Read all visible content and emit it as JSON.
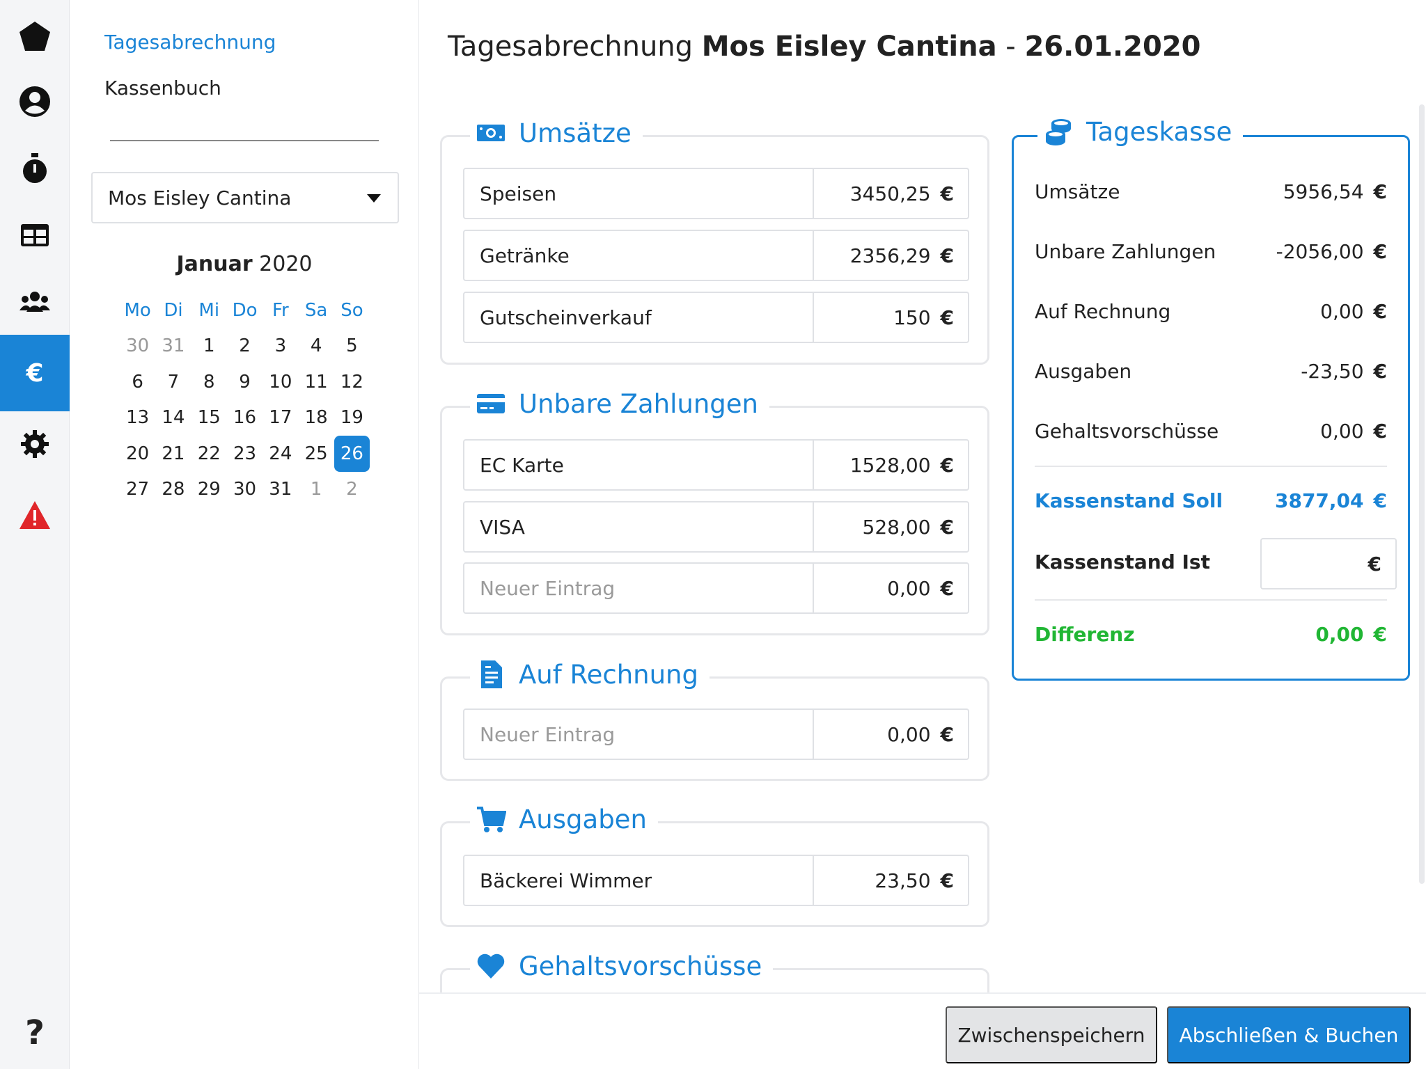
{
  "nav": {
    "subnav": [
      {
        "label": "Tagesabrechnung",
        "active": true
      },
      {
        "label": "Kassenbuch",
        "active": false
      }
    ],
    "venue_select": "Mos Eisley Cantina"
  },
  "calendar": {
    "month": "Januar",
    "year": "2020",
    "weekdays": [
      "Mo",
      "Di",
      "Mi",
      "Do",
      "Fr",
      "Sa",
      "So"
    ],
    "days": [
      {
        "d": "30",
        "m": true
      },
      {
        "d": "31",
        "m": true
      },
      {
        "d": "1"
      },
      {
        "d": "2"
      },
      {
        "d": "3"
      },
      {
        "d": "4"
      },
      {
        "d": "5"
      },
      {
        "d": "6"
      },
      {
        "d": "7"
      },
      {
        "d": "8"
      },
      {
        "d": "9"
      },
      {
        "d": "10"
      },
      {
        "d": "11"
      },
      {
        "d": "12"
      },
      {
        "d": "13"
      },
      {
        "d": "14"
      },
      {
        "d": "15"
      },
      {
        "d": "16"
      },
      {
        "d": "17"
      },
      {
        "d": "18"
      },
      {
        "d": "19"
      },
      {
        "d": "20"
      },
      {
        "d": "21"
      },
      {
        "d": "22"
      },
      {
        "d": "23"
      },
      {
        "d": "24"
      },
      {
        "d": "25"
      },
      {
        "d": "26",
        "sel": true
      },
      {
        "d": "27"
      },
      {
        "d": "28"
      },
      {
        "d": "29"
      },
      {
        "d": "30"
      },
      {
        "d": "31"
      },
      {
        "d": "1",
        "m": true
      },
      {
        "d": "2",
        "m": true
      }
    ]
  },
  "header": {
    "prefix": "Tagesabrechnung",
    "venue": "Mos Eisley Cantina",
    "sep": "-",
    "date": "26.01.2020"
  },
  "currency": "€",
  "sections": {
    "umsaetze": {
      "title": "Umsätze",
      "rows": [
        {
          "label": "Speisen",
          "value": "3450,25"
        },
        {
          "label": "Getränke",
          "value": "2356,29"
        },
        {
          "label": "Gutscheinverkauf",
          "value": "150"
        }
      ]
    },
    "unbar": {
      "title": "Unbare Zahlungen",
      "rows": [
        {
          "label": "EC Karte",
          "value": "1528,00"
        },
        {
          "label": "VISA",
          "value": "528,00"
        },
        {
          "placeholder": "Neuer Eintrag",
          "value": "0,00"
        }
      ]
    },
    "rechnung": {
      "title": "Auf Rechnung",
      "rows": [
        {
          "placeholder": "Neuer Eintrag",
          "value": "0,00"
        }
      ]
    },
    "ausgaben": {
      "title": "Ausgaben",
      "rows": [
        {
          "label": "Bäckerei Wimmer",
          "value": "23,50"
        }
      ]
    },
    "gehalt": {
      "title": "Gehaltsvorschüsse"
    }
  },
  "tageskasse": {
    "title": "Tageskasse",
    "lines": [
      {
        "label": "Umsätze",
        "value": "5956,54"
      },
      {
        "label": "Unbare Zahlungen",
        "value": "-2056,00"
      },
      {
        "label": "Auf Rechnung",
        "value": "0,00"
      },
      {
        "label": "Ausgaben",
        "value": "-23,50"
      },
      {
        "label": "Gehaltsvorschüsse",
        "value": "0,00"
      }
    ],
    "soll_label": "Kassenstand Soll",
    "soll_value": "3877,04",
    "ist_label": "Kassenstand Ist",
    "ist_value": "",
    "diff_label": "Differenz",
    "diff_value": "0,00"
  },
  "footer": {
    "save_label": "Zwischenspeichern",
    "book_label": "Abschließen & Buchen"
  },
  "colors": {
    "accent": "#1a84d6",
    "success": "#21b634",
    "danger": "#e0262a"
  }
}
